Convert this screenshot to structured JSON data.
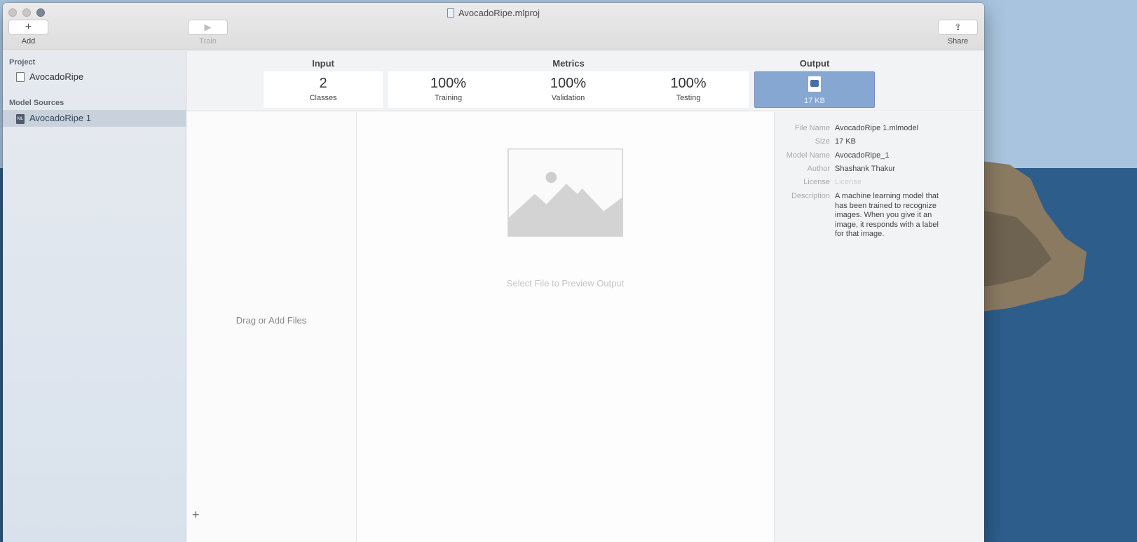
{
  "window": {
    "title": "AvocadoRipe.mlproj"
  },
  "toolbar": {
    "add_glyph": "+",
    "add_label": "Add",
    "train_glyph": "▶",
    "train_label": "Train",
    "share_glyph": "⇪",
    "share_label": "Share"
  },
  "sidebar": {
    "project_header": "Project",
    "project_name": "AvocadoRipe",
    "model_sources_header": "Model Sources",
    "model_source": "AvocadoRipe 1",
    "ml_badge": "ML"
  },
  "summary": {
    "input_title": "Input",
    "metrics_title": "Metrics",
    "output_title": "Output",
    "classes_value": "2",
    "classes_label": "Classes",
    "training_value": "100%",
    "training_label": "Training",
    "validation_value": "100%",
    "validation_label": "Validation",
    "testing_value": "100%",
    "testing_label": "Testing",
    "output_size": "17 KB"
  },
  "left_pane": {
    "drag_text": "Drag or Add Files",
    "plus": "+"
  },
  "preview": {
    "text": "Select File to Preview Output"
  },
  "details": {
    "file_name_label": "File Name",
    "file_name": "AvocadoRipe 1.mlmodel",
    "size_label": "Size",
    "size": "17 KB",
    "model_name_label": "Model Name",
    "model_name": "AvocadoRipe_1",
    "author_label": "Author",
    "author": "Shashank Thakur",
    "license_label": "License",
    "license_placeholder": "License",
    "description_label": "Description",
    "description": "A machine learning model that has been trained to recognize images. When you give it an image, it responds with a label for that image."
  },
  "colors": {
    "output_card": "#86a7d1",
    "selected_row": "#c9d2dc"
  }
}
